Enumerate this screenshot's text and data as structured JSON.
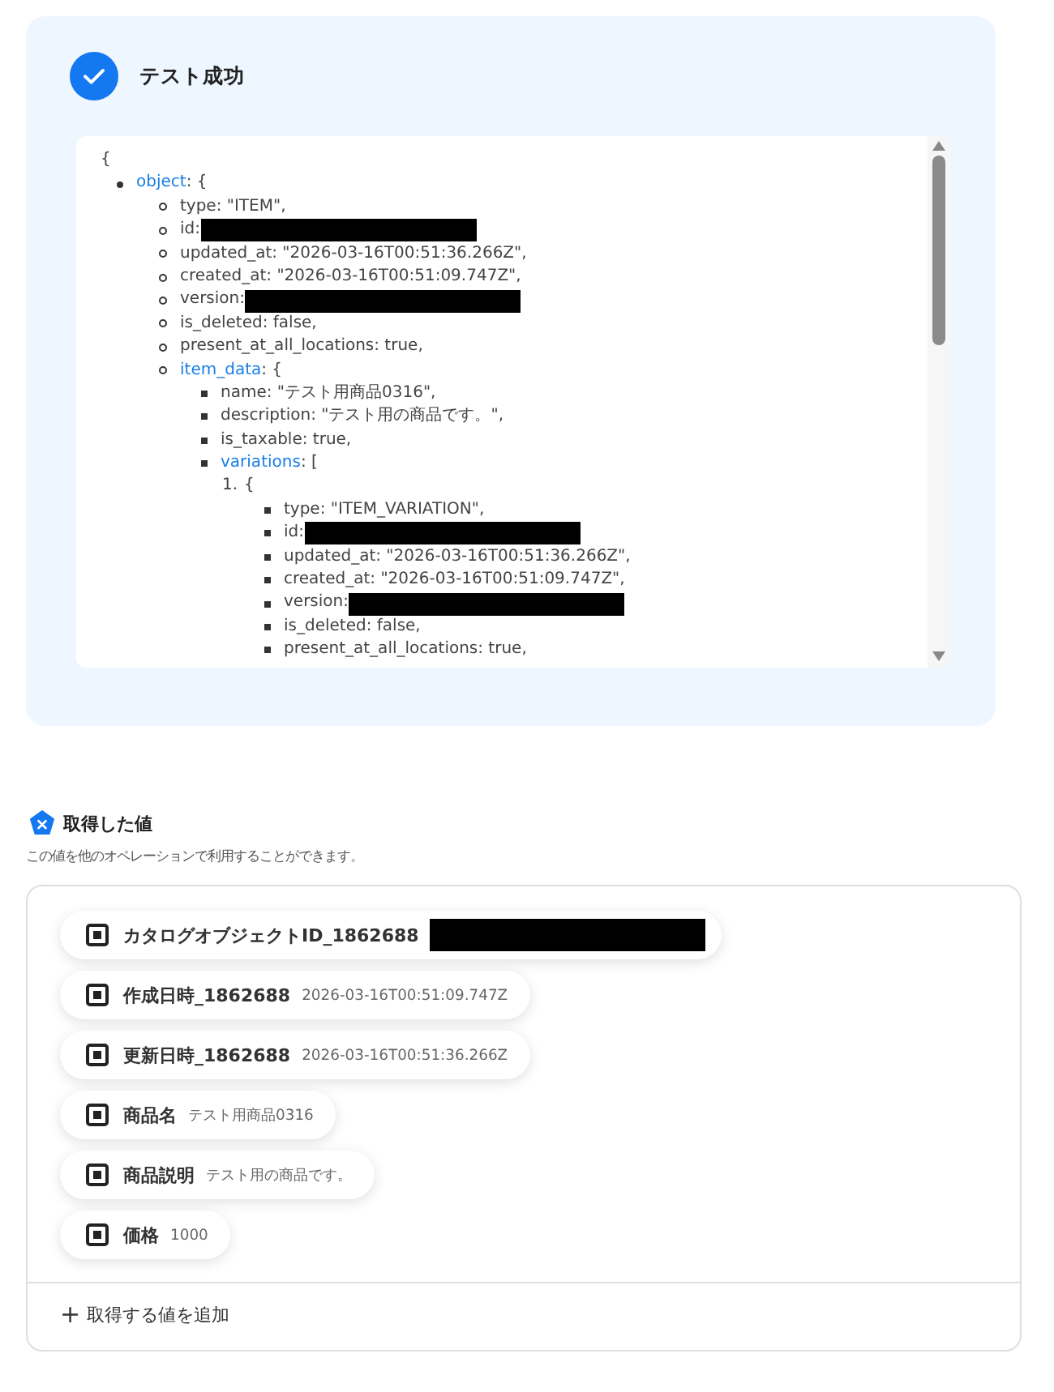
{
  "test_result": {
    "title": "テスト成功",
    "json_view": {
      "open": "{",
      "items": [
        {
          "key": "object",
          "text": ": {",
          "children": [
            {
              "text": "type: \"ITEM\","
            },
            {
              "text": "id:",
              "redacted": true
            },
            {
              "text": "updated_at: \"2026-03-16T00:51:36.266Z\","
            },
            {
              "text": "created_at: \"2026-03-16T00:51:09.747Z\","
            },
            {
              "text": "version:",
              "redacted": true
            },
            {
              "text": "is_deleted: false,"
            },
            {
              "text": "present_at_all_locations: true,"
            },
            {
              "key": "item_data",
              "text": ": {",
              "children": [
                {
                  "text": "name: \"テスト用商品0316\","
                },
                {
                  "text": "description: \"テスト用の商品です。\","
                },
                {
                  "text": "is_taxable: true,"
                },
                {
                  "key": "variations",
                  "text": ": [",
                  "ordered_children": [
                    {
                      "marker": "1.",
                      "text": "{",
                      "children": [
                        {
                          "text": "type: \"ITEM_VARIATION\","
                        },
                        {
                          "text": "id:",
                          "redacted": true
                        },
                        {
                          "text": "updated_at: \"2026-03-16T00:51:36.266Z\","
                        },
                        {
                          "text": "created_at: \"2026-03-16T00:51:09.747Z\","
                        },
                        {
                          "text": "version:",
                          "redacted": true
                        },
                        {
                          "text": "is_deleted: false,"
                        },
                        {
                          "text": "present_at_all_locations: true,"
                        }
                      ]
                    }
                  ]
                }
              ]
            }
          ]
        }
      ]
    }
  },
  "acquired_values": {
    "title": "取得した値",
    "description": "この値を他のオペレーションで利用することができます。",
    "chips": [
      {
        "label": "カタログオブジェクトID_1862688",
        "redacted": true
      },
      {
        "label": "作成日時_1862688",
        "value": "2026-03-16T00:51:09.747Z"
      },
      {
        "label": "更新日時_1862688",
        "value": "2026-03-16T00:51:36.266Z"
      },
      {
        "label": "商品名",
        "value": "テスト用商品0316"
      },
      {
        "label": "商品説明",
        "value": "テスト用の商品です。"
      },
      {
        "label": "価格",
        "value": "1000"
      }
    ],
    "add_button": {
      "icon": "+",
      "label": "取得する値を追加"
    }
  }
}
